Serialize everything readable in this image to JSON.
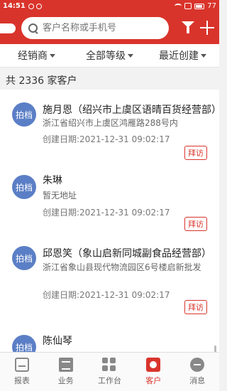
{
  "status_bar": {
    "time": "14:51",
    "battery": "77"
  },
  "search": {
    "placeholder": "客户名称或手机号"
  },
  "filters": [
    {
      "label": "经销商"
    },
    {
      "label": "全部等级"
    },
    {
      "label": "最近创建"
    }
  ],
  "customer_count": "共 2336 家客户",
  "customers": [
    {
      "avatar": "拍档",
      "name": "施月恩（绍兴市上虞区语晴百货经营部）",
      "address": "浙江省绍兴市上虞区鸿雁路288号内",
      "created": "创建日期:2021-12-31 09:02:17",
      "visit": "拜访"
    },
    {
      "avatar": "拍档",
      "name": "朱琳",
      "address": "暂无地址",
      "created": "创建日期:2021-12-31 09:02:17",
      "visit": "拜访"
    },
    {
      "avatar": "拍档",
      "name": "邱恩笑（象山启新同城副食品经营部）",
      "address": "浙江省象山县现代物流园区6号楼启新批发",
      "created": "创建日期:2021-12-31 09:02:17",
      "visit": "拜访"
    },
    {
      "avatar": "拍档",
      "name": "陈仙琴"
    }
  ],
  "tabs": [
    {
      "label": "报表",
      "icon": "report-icon"
    },
    {
      "label": "业务",
      "icon": "business-icon"
    },
    {
      "label": "工作台",
      "icon": "workbench-icon"
    },
    {
      "label": "客户",
      "icon": "customer-icon"
    },
    {
      "label": "消息",
      "icon": "message-icon"
    }
  ],
  "colors": {
    "brand_red": "#d9342b",
    "avatar_blue": "#5b7fc6"
  }
}
